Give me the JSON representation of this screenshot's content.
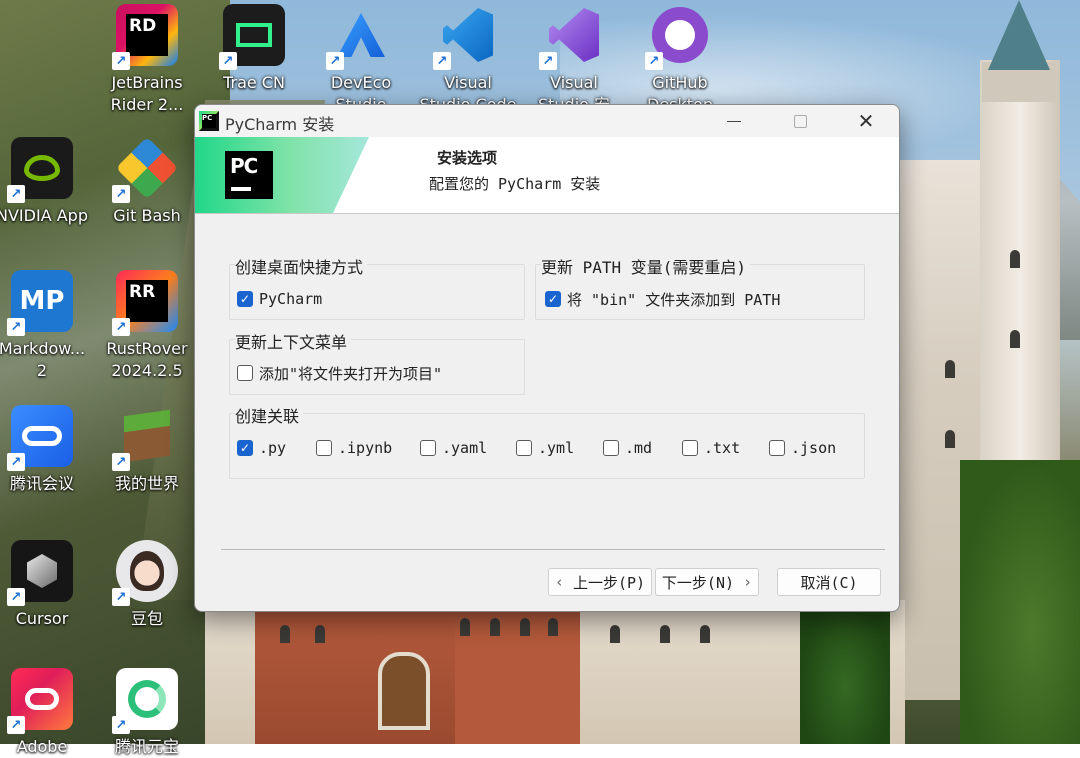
{
  "desktop": {
    "icons": [
      {
        "label1": "JetBrains",
        "label2": "Rider 2...",
        "glyph": "RD",
        "icon": "rider-icon"
      },
      {
        "label1": "Trae CN",
        "label2": "",
        "glyph": "",
        "icon": "trae-icon"
      },
      {
        "label1": "DevEco",
        "label2": "Studio",
        "glyph": "",
        "icon": "deveco-icon"
      },
      {
        "label1": "Visual",
        "label2": "Studio Code",
        "glyph": "",
        "icon": "vscode-icon"
      },
      {
        "label1": "Visual",
        "label2": "Studio 安",
        "glyph": "",
        "icon": "visual-studio-icon"
      },
      {
        "label1": "GitHub",
        "label2": "Desktop",
        "glyph": "",
        "icon": "github-icon"
      },
      {
        "label1": "NVIDIA App",
        "label2": "",
        "glyph": "",
        "icon": "nvidia-icon"
      },
      {
        "label1": "Git Bash",
        "label2": "",
        "glyph": "",
        "icon": "git-bash-icon"
      },
      {
        "label1": "Markdow...",
        "label2": "2",
        "glyph": "MP",
        "icon": "markdown-icon"
      },
      {
        "label1": "RustRover",
        "label2": "2024.2.5",
        "glyph": "RR",
        "icon": "rustrover-icon"
      },
      {
        "label1": "腾讯会议",
        "label2": "",
        "glyph": "",
        "icon": "tencent-meeting-icon"
      },
      {
        "label1": "我的世界",
        "label2": "",
        "glyph": "",
        "icon": "minecraft-icon"
      },
      {
        "label1": "Cursor",
        "label2": "",
        "glyph": "",
        "icon": "cursor-icon"
      },
      {
        "label1": "豆包",
        "label2": "",
        "glyph": "",
        "icon": "doubao-icon"
      },
      {
        "label1": "Adobe",
        "label2": "",
        "glyph": "",
        "icon": "adobe-cc-icon"
      },
      {
        "label1": "腾讯元宝",
        "label2": "",
        "glyph": "",
        "icon": "yuanbao-icon"
      }
    ]
  },
  "installer": {
    "window_title": "PyCharm 安装",
    "app_icon_glyph": "PC",
    "banner_logo_glyph": "PC",
    "banner_title": "安装选项",
    "banner_subtitle": "配置您的 PyCharm 安装",
    "groups": {
      "shortcut": {
        "title": "创建桌面快捷方式",
        "options": [
          {
            "label": "PyCharm",
            "checked": true
          }
        ]
      },
      "path": {
        "title": "更新 PATH 变量(需要重启)",
        "options": [
          {
            "label": "将 \"bin\" 文件夹添加到 PATH",
            "checked": true
          }
        ]
      },
      "context": {
        "title": "更新上下文菜单",
        "options": [
          {
            "label": "添加\"将文件夹打开为项目\"",
            "checked": false
          }
        ]
      },
      "assoc": {
        "title": "创建关联",
        "options": [
          {
            "label": ".py",
            "checked": true
          },
          {
            "label": ".ipynb",
            "checked": false
          },
          {
            "label": ".yaml",
            "checked": false
          },
          {
            "label": ".yml",
            "checked": false
          },
          {
            "label": ".md",
            "checked": false
          },
          {
            "label": ".txt",
            "checked": false
          },
          {
            "label": ".json",
            "checked": false
          }
        ]
      }
    },
    "buttons": {
      "back": "上一步(P)",
      "next": "下一步(N)",
      "cancel": "取消(C)"
    },
    "colors": {
      "check_accent": "#1a64cf",
      "banner_green": "#21d789"
    }
  }
}
